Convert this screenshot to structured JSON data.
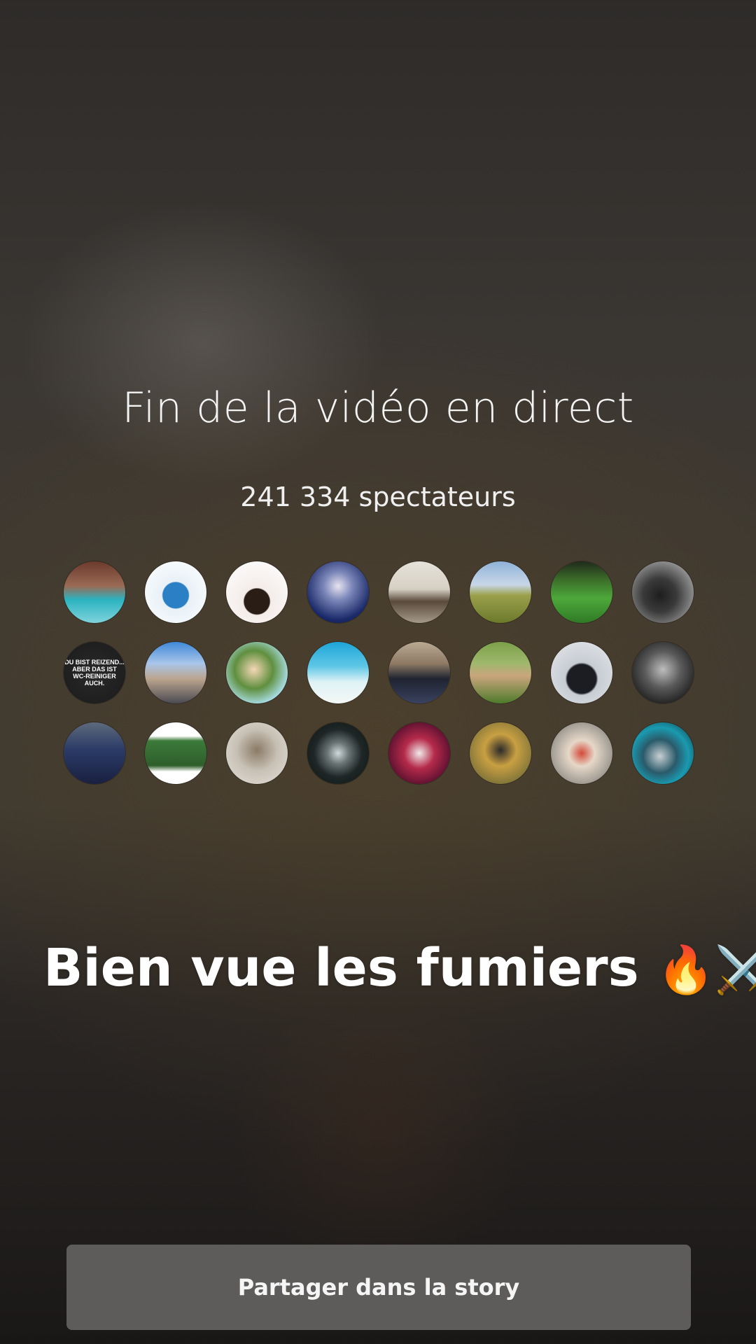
{
  "title": "Fin de la vidéo en direct",
  "viewers_label": "241 334 spectateurs",
  "caption": {
    "text": "Bien vue les fumiers",
    "emojis": "🔥⚔️"
  },
  "share_button_label": "Partager dans la story",
  "avatars": [
    {
      "bg": "linear-gradient(180deg,#6b3a2c 0%,#9a6a55 40%,#2bb3c0 62%,#7fd3dc 100%)"
    },
    {
      "bg": "radial-gradient(circle at 50% 55%,#2b7fc4 0%,#2b7fc4 28%,#e8f1f7 30%,#ffffff 100%)"
    },
    {
      "bg": "radial-gradient(circle at 50% 65%,#2a1d16 0%,#2a1d16 25%,#f3ece9 27%,#ffffff 100%)"
    },
    {
      "bg": "radial-gradient(circle at 50% 40%,#e8e3f0 0%,#7a86b8 30%,#1b2a6a 70%,#0b1240 100%)"
    },
    {
      "bg": "linear-gradient(180deg,#e6e2da 0%,#d6d0c4 45%,#5a4a3c 65%,#a59a8a 100%)"
    },
    {
      "bg": "linear-gradient(180deg,#8fb2d8 0%,#c8d7e8 38%,#9aa04a 55%,#6c7a2c 100%)"
    },
    {
      "bg": "linear-gradient(180deg,#1f2a1a 0%,#3c6e2a 30%,#4da83a 60%,#2f7a26 100%)"
    },
    {
      "bg": "radial-gradient(circle at 45% 55%,#1e1e1e 0%,#3a3a3a 35%,#8a8a8a 70%,#c8c8c8 100%)"
    },
    {
      "bg": "radial-gradient(circle,#2a2a2a 0%,#1a1a1a 100%)",
      "text": "DU BIST REIZEND...\nABER DAS IST\nWC-REINIGER AUCH."
    },
    {
      "bg": "linear-gradient(180deg,#3e88d8 0%,#a9c6ea 35%,#bba48e 60%,#4a4a52 100%)"
    },
    {
      "bg": "radial-gradient(circle at 45% 45%,#f5d7b5 0%,#5f8f3e 40%,#aee2f0 75%,#ffffff 100%)"
    },
    {
      "bg": "linear-gradient(180deg,#1ea5d8 0%,#5fc7e6 40%,#dff2f6 65%,#f4f8f5 100%)"
    },
    {
      "bg": "linear-gradient(180deg,#b9aa94 0%,#8f7a64 35%,#1e2430 60%,#3a4260 100%)"
    },
    {
      "bg": "linear-gradient(180deg,#7ca04a 0%,#9fb86c 35%,#c9a57c 55%,#4d7a2a 100%)"
    },
    {
      "bg": "radial-gradient(circle at 50% 60%,#1b1d22 0%,#1b1d22 30%,#c7ccd3 34%,#e6e9ec 100%)"
    },
    {
      "bg": "radial-gradient(circle at 50% 45%,#bdbdbd 0%,#5a5a5a 40%,#1c1c1c 80%)"
    },
    {
      "bg": "linear-gradient(180deg,#5d6a7c 0%,#2a3a66 45%,#1a2040 100%)"
    },
    {
      "bg": "linear-gradient(180deg,#ffffff 0%,#ffffff 22%,#3c7a3a 30%,#2e5e2a 70%,#ffffff 80%,#ffffff 100%)"
    },
    {
      "bg": "radial-gradient(circle at 50% 45%,#8a7a66 0%,#c7c0b4 45%,#e4e2dc 100%)"
    },
    {
      "bg": "radial-gradient(circle at 50% 50%,#cfd9db 0%,#6a7474 25%,#1e2626 55%,#0f1414 100%)"
    },
    {
      "bg": "radial-gradient(circle at 50% 50%,#f0eaea 0%,#b52a4a 35%,#5a1030 75%,#2a0818 100%)"
    },
    {
      "bg": "radial-gradient(circle at 50% 45%,#2c2a2a 0%,#c9a042 35%,#8a7a3a 70%,#4e5a2a 100%)"
    },
    {
      "bg": "radial-gradient(circle at 50% 50%,#d44a3a 0%,#e6d8c8 30%,#a9a39a 65%,#6b6660 100%)"
    },
    {
      "bg": "radial-gradient(circle at 45% 55%,#c8cfd3 0%,#2a5a6a 35%,#1a9ab0 60%,#0e2a34 100%)"
    }
  ]
}
